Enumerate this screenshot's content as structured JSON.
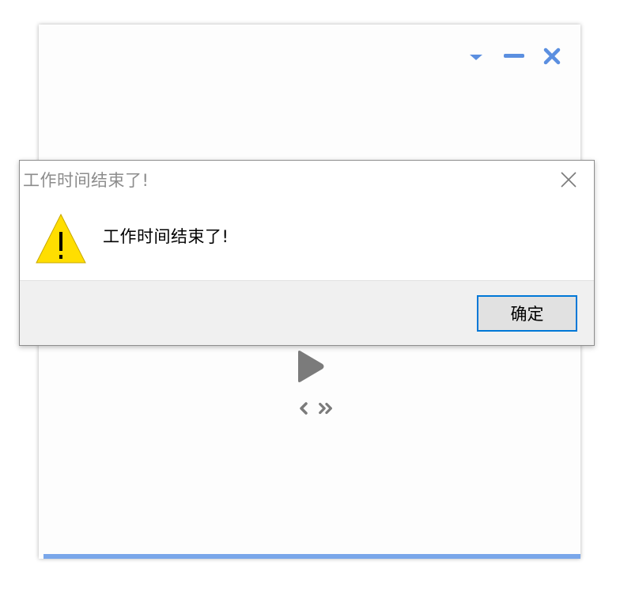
{
  "app": {
    "accent_color": "#5b8fe0",
    "controls": {
      "menu_icon": "caret-down-icon",
      "minimize_icon": "minimize-icon",
      "close_icon": "close-icon"
    },
    "player": {
      "play_icon": "play-icon",
      "prev_icon": "chevron-left-icon",
      "skip_icon": "double-chevron-right-icon"
    },
    "progress": {
      "fraction": 1.0,
      "color": "#7aa7ea"
    }
  },
  "dialog": {
    "title": "工作时间结束了!",
    "message": "工作时间结束了!",
    "icon": "warning-icon",
    "ok_label": "确定",
    "close_icon": "close-icon"
  }
}
